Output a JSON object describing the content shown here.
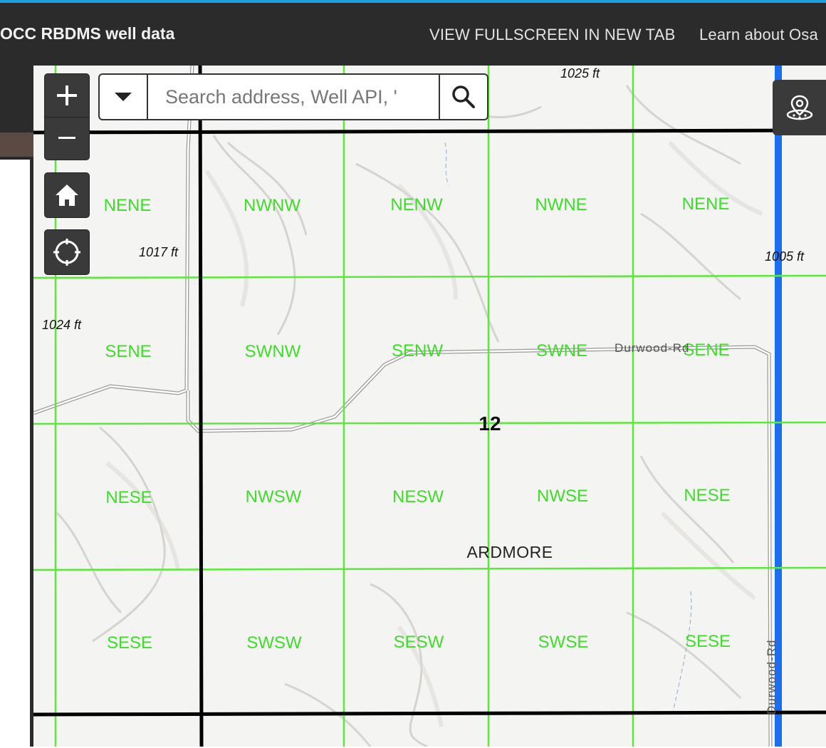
{
  "header": {
    "title": "OCC RBDMS well data",
    "fullscreen_link": "VIEW FULLSCREEN IN NEW TAB",
    "learn_link": "Learn about Osa"
  },
  "search": {
    "placeholder": "Search address, Well API, '"
  },
  "map": {
    "section_number": "12",
    "place_label": "ARDMORE",
    "road_label": "Durwood-Rd",
    "elevations": {
      "e1025": "1025 ft",
      "e1017": "1017 ft",
      "e1024": "1024 ft",
      "e1005": "1005 ft"
    },
    "quarter_labels": {
      "r1": [
        "NENE",
        "NWNW",
        "NENW",
        "NWNE",
        "NENE"
      ],
      "r2": [
        "SENE",
        "SWNW",
        "SENW",
        "SWNE",
        "SENE"
      ],
      "r3": [
        "NESE",
        "NWSW",
        "NESW",
        "NWSE",
        "NESE"
      ],
      "r4": [
        "SESE",
        "SWSW",
        "SESW",
        "SWSE",
        "SESE"
      ]
    },
    "colors": {
      "qq_grid": "#5ce83a",
      "section_line": "#000000",
      "highway": "#1a6ef0",
      "label_text": "#3fdc2a"
    }
  },
  "controls": {
    "zoom_in_icon": "plus-icon",
    "zoom_out_icon": "minus-icon",
    "home_icon": "home-icon",
    "locate_icon": "crosshair-icon",
    "search_icon": "magnifier-icon",
    "dropdown_icon": "caret-down-icon",
    "layer_locate_icon": "map-pin-icon"
  }
}
